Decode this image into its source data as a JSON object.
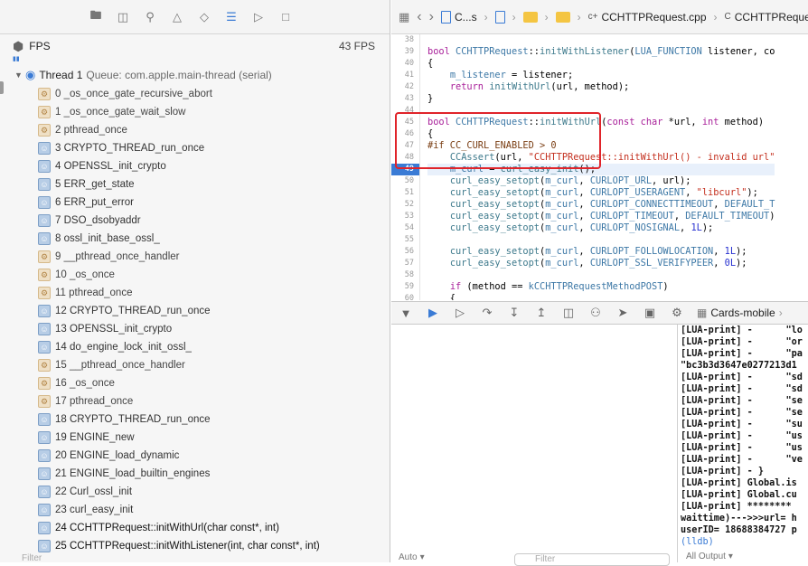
{
  "navigator": {
    "toolbar_icons": [
      "folder-icon",
      "hierarchy-icon",
      "search-icon",
      "warning-icon",
      "diamond-icon",
      "debug-navigator-icon",
      "breakpoint-icon",
      "report-icon"
    ],
    "fps_label": "FPS",
    "fps_value": "43 FPS",
    "thread_label": "Thread 1",
    "thread_queue": "Queue: com.apple.main-thread (serial)",
    "frames": [
      {
        "label": "0 _os_once_gate_recursive_abort",
        "kind": "sys"
      },
      {
        "label": "1 _os_once_gate_wait_slow",
        "kind": "sys"
      },
      {
        "label": "2 pthread_once",
        "kind": "sys"
      },
      {
        "label": "3 CRYPTO_THREAD_run_once",
        "kind": "usr"
      },
      {
        "label": "4 OPENSSL_init_crypto",
        "kind": "usr"
      },
      {
        "label": "5 ERR_get_state",
        "kind": "usr"
      },
      {
        "label": "6 ERR_put_error",
        "kind": "usr"
      },
      {
        "label": "7 DSO_dsobyaddr",
        "kind": "usr"
      },
      {
        "label": "8 ossl_init_base_ossl_",
        "kind": "usr"
      },
      {
        "label": "9 __pthread_once_handler",
        "kind": "sys"
      },
      {
        "label": "10 _os_once",
        "kind": "sys"
      },
      {
        "label": "11 pthread_once",
        "kind": "sys"
      },
      {
        "label": "12 CRYPTO_THREAD_run_once",
        "kind": "usr"
      },
      {
        "label": "13 OPENSSL_init_crypto",
        "kind": "usr"
      },
      {
        "label": "14 do_engine_lock_init_ossl_",
        "kind": "usr"
      },
      {
        "label": "15 __pthread_once_handler",
        "kind": "sys"
      },
      {
        "label": "16 _os_once",
        "kind": "sys"
      },
      {
        "label": "17 pthread_once",
        "kind": "sys"
      },
      {
        "label": "18 CRYPTO_THREAD_run_once",
        "kind": "usr"
      },
      {
        "label": "19 ENGINE_new",
        "kind": "usr"
      },
      {
        "label": "20 ENGINE_load_dynamic",
        "kind": "usr"
      },
      {
        "label": "21 ENGINE_load_builtin_engines",
        "kind": "usr"
      },
      {
        "label": "22 Curl_ossl_init",
        "kind": "usr"
      },
      {
        "label": "23 curl_easy_init",
        "kind": "usr"
      },
      {
        "label": "24 CCHTTPRequest::initWithUrl(char const*, int)",
        "kind": "usr",
        "strong": true
      },
      {
        "label": "25 CCHTTPRequest::initWithListener(int, char const*, int)",
        "kind": "usr",
        "strong": true
      }
    ],
    "filter_placeholder": "Filter"
  },
  "jumpbar": {
    "crumb_project": "C...s",
    "crumb_file": "CCHTTPRequest.cpp",
    "crumb_class": "CCHTTPRequest"
  },
  "editor": {
    "line_numbers": [
      "38",
      "39",
      "40",
      "41",
      "42",
      "43",
      "44",
      "45",
      "46",
      "47",
      "48",
      "49",
      "50",
      "51",
      "52",
      "53",
      "54",
      "55",
      "56",
      "57",
      "58",
      "59",
      "60"
    ],
    "current_line": "49"
  },
  "debugbar": {
    "target": "Cards-mobile"
  },
  "console": {
    "lines": [
      "[LUA-print] -      \"lo",
      "[LUA-print] -      \"or",
      "[LUA-print] -      \"pa",
      "\"bc3b3d3647e0277213d1",
      "[LUA-print] -      \"sd",
      "[LUA-print] -      \"sd",
      "[LUA-print] -      \"se",
      "[LUA-print] -      \"se",
      "[LUA-print] -      \"su",
      "[LUA-print] -      \"us",
      "[LUA-print] -      \"us",
      "[LUA-print] -      \"ve",
      "[LUA-print] - }",
      "[LUA-print] Global.is",
      "[LUA-print] Global.cu",
      "[LUA-print] ********",
      "waittime)--->>>url= h",
      "userID= 18688384727 p"
    ],
    "prompt": "(lldb)",
    "output_label": "All Output"
  },
  "vars": {
    "auto_label": "Auto",
    "filter_placeholder": "Filter"
  }
}
